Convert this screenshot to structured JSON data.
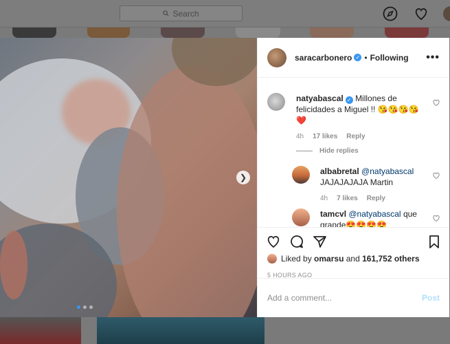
{
  "header": {
    "search_placeholder": "Search"
  },
  "post": {
    "author": "saracarbonero",
    "follow_status": "Following",
    "more_label": "•••"
  },
  "comments": [
    {
      "user": "natyabascal",
      "verified": true,
      "text": "Millones de felicidades a Miguel !! 😘😘😘😘",
      "emoji_line": "❤️",
      "time": "4h",
      "likes": "17 likes",
      "reply": "Reply",
      "hide_replies": "Hide replies"
    }
  ],
  "replies": [
    {
      "user": "albabretal",
      "mention": "@natyabascal",
      "text": "JAJAJAJAJA Martin",
      "time": "4h",
      "likes": "7 likes",
      "reply": "Reply"
    },
    {
      "user": "tamcvl",
      "mention": "@natyabascal",
      "text": "que",
      "text2": "grande😍😍😍😍"
    }
  ],
  "engagement": {
    "liked_by_prefix": "Liked by",
    "liked_by_user": "omarsu",
    "liked_by_suffix": "and",
    "others": "161,752 others",
    "timestamp": "5 HOURS AGO"
  },
  "composer": {
    "placeholder": "Add a comment...",
    "post_label": "Post"
  },
  "carousel": {
    "current": 1,
    "total": 3,
    "next_icon": "chevron-right-icon"
  },
  "colors": {
    "accent": "#3897f0",
    "post_disabled": "#b2dffc",
    "mention": "#00376b",
    "heart_red": "#ed4956"
  }
}
